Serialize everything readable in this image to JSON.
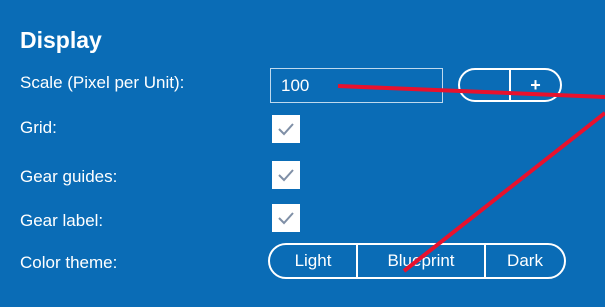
{
  "display": {
    "heading": "Display",
    "scale": {
      "label": "Scale (Pixel per Unit):",
      "value": "100",
      "decrement_label": "",
      "increment_label": "+"
    },
    "grid": {
      "label": "Grid:",
      "checked": true
    },
    "gear_guides": {
      "label": "Gear guides:",
      "checked": true
    },
    "gear_label": {
      "label": "Gear label:",
      "checked": true
    },
    "color_theme": {
      "label": "Color theme:",
      "options": [
        "Light",
        "Blueprint",
        "Dark"
      ]
    }
  },
  "colors": {
    "background": "#0A6CB6",
    "text": "#FFFFFF",
    "annotation": "#E8112D"
  }
}
